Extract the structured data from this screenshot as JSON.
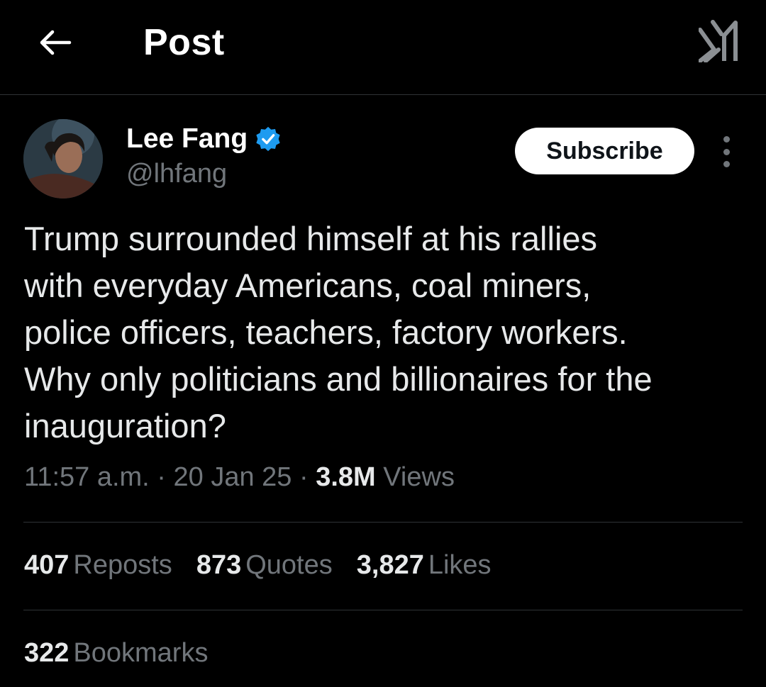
{
  "header": {
    "title": "Post",
    "back_icon": "arrow-left-icon",
    "right_icon": "grok-icon"
  },
  "author": {
    "name": "Lee Fang",
    "handle": "@lhfang",
    "verified": true,
    "verified_color": "#1d9bf0",
    "subscribe_label": "Subscribe"
  },
  "tweet": {
    "lines": [
      "Trump surrounded himself at his rallies",
      "with everyday Americans, coal miners,",
      "police officers, teachers, factory workers.",
      "Why only politicians and billionaires for the",
      "inauguration?"
    ]
  },
  "meta": {
    "time": "11:57 a.m.",
    "sep1": "·",
    "date": "20 Jan 25",
    "sep2": "·",
    "views_count": "3.8M",
    "views_label": "Views"
  },
  "stats": {
    "reposts_count": "407",
    "reposts_label": "Reposts",
    "quotes_count": "873",
    "quotes_label": "Quotes",
    "likes_count": "3,827",
    "likes_label": "Likes",
    "bookmarks_count": "322",
    "bookmarks_label": "Bookmarks"
  },
  "colors": {
    "background": "#000000",
    "text_primary": "#e7e9ea",
    "text_secondary": "#71767b",
    "divider": "#2f3336"
  }
}
